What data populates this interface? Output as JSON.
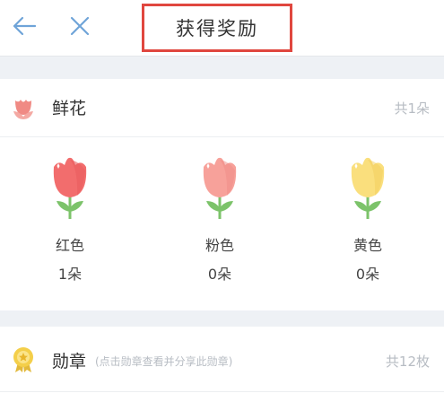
{
  "header": {
    "title": "获得奖励",
    "back_icon": "arrow-left-icon",
    "close_icon": "close-icon"
  },
  "flowers_section": {
    "title": "鲜花",
    "count_text": "共1朵",
    "icon": "flower-icon",
    "items": [
      {
        "name": "红色",
        "count": "1朵",
        "color": "#f26d6d"
      },
      {
        "name": "粉色",
        "count": "0朵",
        "color": "#f7a19a"
      },
      {
        "name": "黄色",
        "count": "0朵",
        "color": "#fadf7d"
      }
    ]
  },
  "medal_section": {
    "title": "勋章",
    "hint": "(点击勋章查看并分享此勋章)",
    "count_text": "共12枚",
    "icon": "medal-icon"
  },
  "colors": {
    "accent_red": "#e0473f",
    "muted_text": "#b7bcc3",
    "leaf_green": "#7cc36a"
  }
}
